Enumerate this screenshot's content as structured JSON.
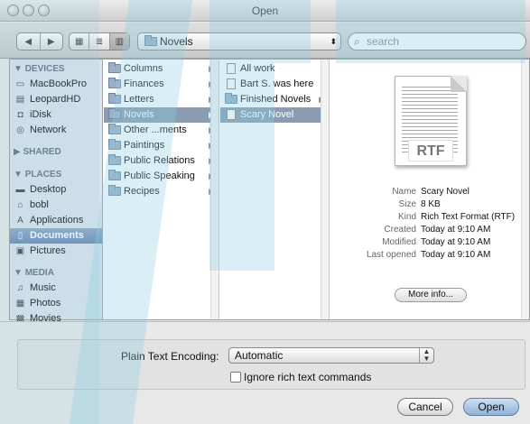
{
  "window": {
    "title": "Open"
  },
  "toolbar": {
    "back_icon": "back-arrow-icon",
    "forward_icon": "forward-arrow-icon",
    "views": [
      "icon-view",
      "list-view",
      "column-view"
    ],
    "path": "Novels",
    "search_placeholder": "search"
  },
  "sidebar": {
    "devices_heading": "DEVICES",
    "devices": [
      "MacBookPro",
      "LeopardHD",
      "iDisk",
      "Network"
    ],
    "shared_heading": "SHARED",
    "places_heading": "PLACES",
    "places": [
      "Desktop",
      "bobl",
      "Applications",
      "Documents",
      "Pictures"
    ],
    "media_heading": "MEDIA",
    "media": [
      "Music",
      "Photos",
      "Movies"
    ]
  },
  "column1": [
    "Columns",
    "Finances",
    "Letters",
    "Novels",
    "Other ...ments",
    "Paintings",
    "Public Relations",
    "Public Speaking",
    "Recipes"
  ],
  "column2": [
    "All work",
    "Bart S. was here",
    "Finished Novels",
    "Scary Novel"
  ],
  "preview": {
    "badge": "RTF",
    "name_label": "Name",
    "name": "Scary Novel",
    "size_label": "Size",
    "size": "8 KB",
    "kind_label": "Kind",
    "kind": "Rich Text Format (RTF)",
    "created_label": "Created",
    "created": "Today at 9:10 AM",
    "modified_label": "Modified",
    "modified": "Today at 9:10 AM",
    "opened_label": "Last opened",
    "opened": "Today at 9:10 AM",
    "more_info": "More info..."
  },
  "options": {
    "encoding_label": "Plain Text Encoding:",
    "encoding_value": "Automatic",
    "ignore_label": "Ignore rich text commands"
  },
  "buttons": {
    "cancel": "Cancel",
    "open": "Open"
  },
  "colors": {
    "sidebar": "#dbe3ec",
    "selection": "#8a9cb1",
    "accent": "#8fb2d8"
  }
}
